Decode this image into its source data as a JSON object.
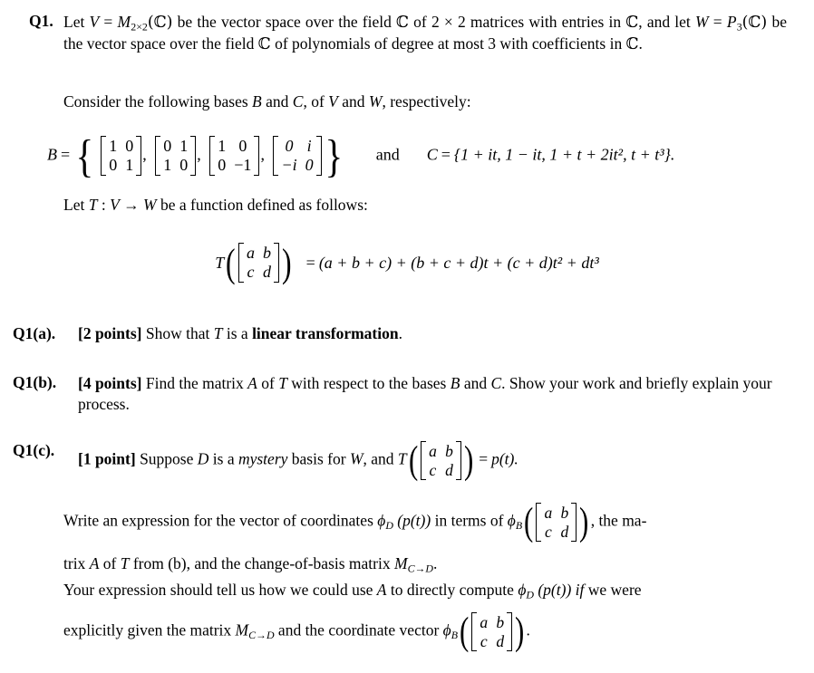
{
  "document": {
    "type": "math-exam-question",
    "question_number": "Q1.",
    "intro": {
      "line1_a": "Let ",
      "line1_V": "V",
      "line1_eq": " = ",
      "line1_M": "M",
      "line1_Msub": "2×2",
      "line1_Marg": "(ℂ)",
      "line1_b": " be the vector space over the field ",
      "line1_C": "ℂ",
      "line1_c": " of 2 × 2 matrices with entries in ",
      "line1_C2": "ℂ",
      "line1_d": ", and let ",
      "line1_W": "W",
      "line1_eq2": " = ",
      "line1_P": "P",
      "line1_Psub": "3",
      "line1_Parg": "(ℂ)",
      "line1_e": " be the vector space over the field ",
      "line1_C3": "ℂ",
      "line1_f": " of polynomials of degree at most 3 with coefficients in ",
      "line1_C4": "ℂ",
      "line1_g": "."
    },
    "consider_line": {
      "before_B": "Consider the following bases ",
      "B": "B",
      "and": " and ",
      "C": "C",
      "of": ", of ",
      "V": "V",
      "and2": " and ",
      "W": "W",
      "after": ", respectively:"
    },
    "bases_equation": {
      "B_label": "B",
      "equals": "=",
      "matrices": [
        {
          "name": "identity",
          "entries": [
            "1",
            "0",
            "0",
            "1"
          ]
        },
        {
          "name": "swap",
          "entries": [
            "0",
            "1",
            "1",
            "0"
          ]
        },
        {
          "name": "pauli-z",
          "entries": [
            "1",
            "0",
            "0",
            "−1"
          ]
        },
        {
          "name": "pauli-y",
          "entries": [
            "0",
            "i",
            "−i",
            "0"
          ]
        }
      ],
      "and_word": "and",
      "C_label": "C",
      "C_equals": "=",
      "C_set": "{1 + it, 1 − it, 1 + t + 2it², t + t³}.",
      "C_items": [
        "1 + it",
        "1 − it",
        "1 + t + 2it²",
        "t + t³"
      ]
    },
    "let_t_line": {
      "before": "Let ",
      "T": "T",
      "colon": " : ",
      "V": "V",
      "arrow": " → ",
      "W": "W",
      "after": " be a function defined as follows:"
    },
    "transformation_equation": {
      "T": "T",
      "matrix_entries": [
        "a",
        "b",
        "c",
        "d"
      ],
      "equals": "=",
      "rhs_term1": "(a + b + c)",
      "rhs_term2": "(b + c + d)t",
      "rhs_term3": "(c + d)t²",
      "rhs_term4": "dt³",
      "rhs_full": "(a + b + c) + (b + c + d)t + (c + d)t² + dt³"
    },
    "parts": [
      {
        "label": "Q1(a).",
        "points": "[2 points]",
        "text_before": " Show that ",
        "T": "T",
        "text_mid": " is a ",
        "bold_phrase": "linear transformation",
        "text_after": "."
      },
      {
        "label": "Q1(b).",
        "points": "[4 points]",
        "text_before": " Find the matrix ",
        "A": "A",
        "text_of": " of ",
        "T": "T",
        "text_mid": " with respect to the bases ",
        "B": "B",
        "and": " and ",
        "C": "C",
        "text_after": ". Show your work and briefly explain your process."
      },
      {
        "label": "Q1(c).",
        "points": "[1 point]",
        "text_before": " Suppose ",
        "D": "D",
        "text_is": " is a ",
        "mystery": "mystery",
        "text_basis": " basis for ",
        "W": "W",
        "text_and": ", and ",
        "T": "T",
        "matrix_entries": [
          "a",
          "b",
          "c",
          "d"
        ],
        "equals": "=",
        "result": "p(t)."
      }
    ],
    "qc_body": {
      "p1_a": "Write an expression for the vector of coordinates ",
      "p1_phiD": "ϕ",
      "p1_phiD_sub": "D",
      "p1_pt": " (p(t))",
      "p1_b": " in terms of ",
      "p1_phiB": "ϕ",
      "p1_phiB_sub": "B",
      "p1_matrix": [
        "a",
        "b",
        "c",
        "d"
      ],
      "p1_c": ", the ma-",
      "p2_a": "trix ",
      "p2_A": "A",
      "p2_b": " of ",
      "p2_T": "T",
      "p2_c": " from (b), and the change-of-basis matrix ",
      "p2_M": "M",
      "p2_Msub": "C→D",
      "p2_d": ".",
      "p3_a": "Your expression should tell us how we could use ",
      "p3_A": "A",
      "p3_b": " to directly compute ",
      "p3_phiD": "ϕ",
      "p3_phiD_sub": "D",
      "p3_pt": " (p(t))",
      "p3_if": " if",
      "p3_c": " we were",
      "p4_a": "explicitly given the matrix ",
      "p4_M": "M",
      "p4_Msub": "C→D",
      "p4_b": " and the coordinate vector ",
      "p4_phiB": "ϕ",
      "p4_phiB_sub": "B",
      "p4_matrix": [
        "a",
        "b",
        "c",
        "d"
      ],
      "p4_c": "."
    },
    "colors": {
      "text": "#000000",
      "background": "#ffffff"
    }
  }
}
